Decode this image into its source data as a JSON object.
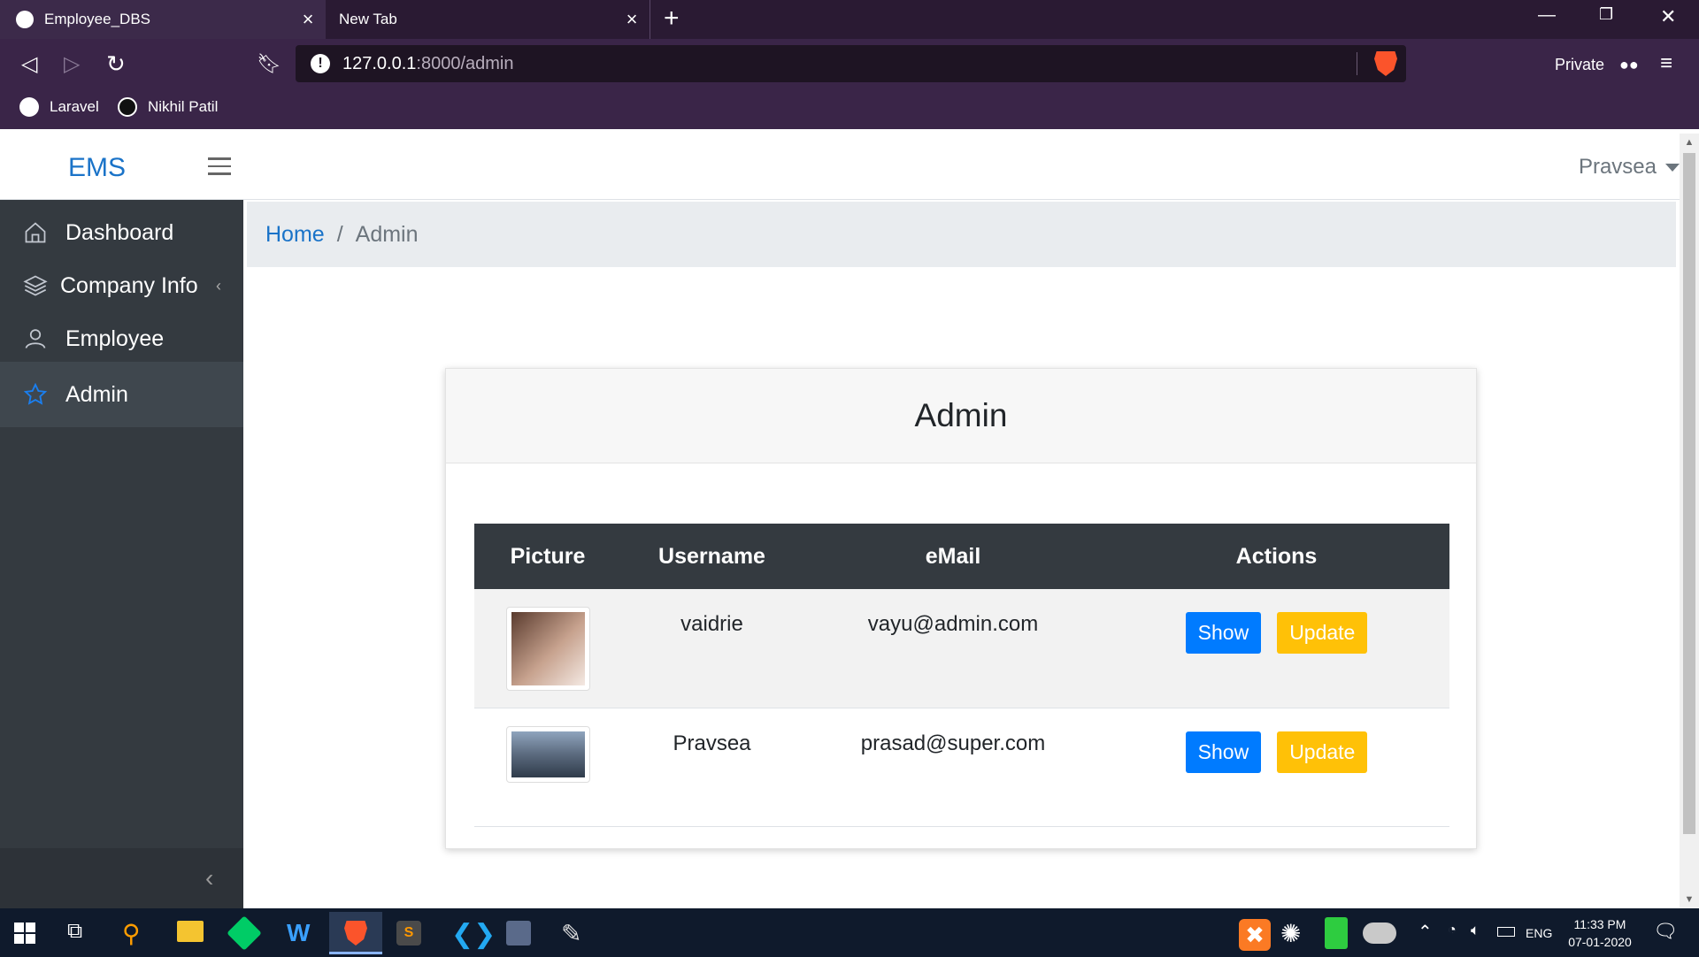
{
  "browser": {
    "tabs": [
      {
        "title": "Employee_DBS",
        "active": true
      },
      {
        "title": "New Tab",
        "active": false
      }
    ],
    "url_host": "127.0.0.1",
    "url_path": ":8000/admin",
    "private_label": "Private",
    "bookmarks": [
      {
        "label": "Laravel",
        "icon": "globe-icon"
      },
      {
        "label": "Nikhil Patil",
        "icon": "github-icon"
      }
    ]
  },
  "app": {
    "brand": "EMS",
    "user_name": "Pravsea",
    "sidebar": {
      "items": [
        {
          "label": "Dashboard",
          "icon": "home-icon"
        },
        {
          "label": "Company Info",
          "icon": "layers-icon"
        },
        {
          "label": "Employee",
          "icon": "user-icon"
        },
        {
          "label": "Admin",
          "icon": "star-icon",
          "active": true
        }
      ]
    },
    "breadcrumb": {
      "home": "Home",
      "current": "Admin"
    },
    "card": {
      "title": "Admin",
      "table": {
        "headers": [
          "Picture",
          "Username",
          "eMail",
          "Actions"
        ],
        "rows": [
          {
            "username": "vaidrie",
            "email": "vayu@admin.com",
            "show": "Show",
            "update": "Update"
          },
          {
            "username": "Pravsea",
            "email": "prasad@super.com",
            "show": "Show",
            "update": "Update"
          }
        ]
      }
    }
  },
  "taskbar": {
    "lang": "ENG",
    "time": "11:33 PM",
    "date": "07-01-2020"
  },
  "colors": {
    "accent": "#007bff",
    "warning": "#ffc107",
    "sidebar_bg": "#343a40",
    "brand": "#1a73c8"
  }
}
